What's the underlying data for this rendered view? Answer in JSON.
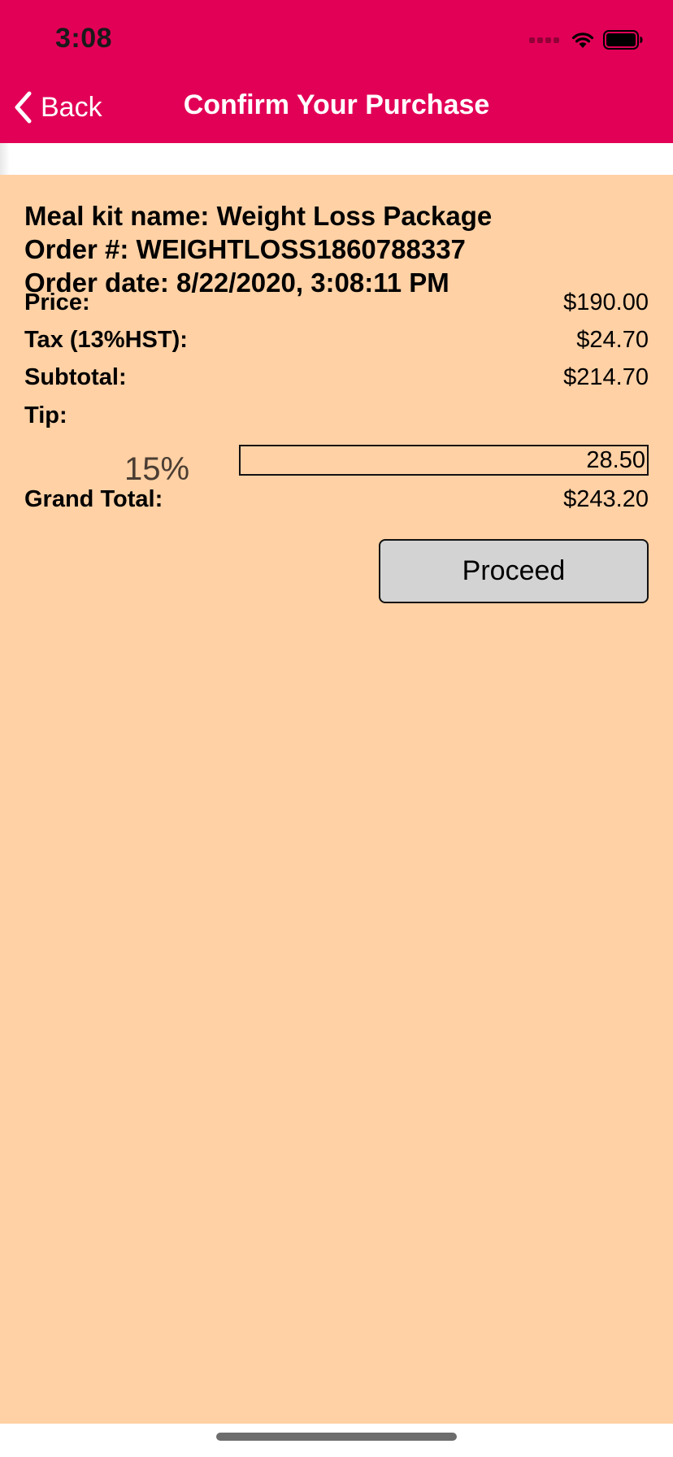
{
  "status_bar": {
    "time": "3:08"
  },
  "nav": {
    "back_label": "Back",
    "title": "Confirm Your Purchase"
  },
  "order": {
    "meal_kit_line": "Meal kit name: Weight Loss Package",
    "order_number_line": "Order #: WEIGHTLOSS1860788337",
    "order_date_line": "Order date: 8/22/2020, 3:08:11 PM"
  },
  "summary": {
    "price_label": "Price:",
    "price_value": "$190.00",
    "tax_label": "Tax (13%HST):",
    "tax_value": "$24.70",
    "subtotal_label": "Subtotal:",
    "subtotal_value": "$214.70",
    "tip_label": "Tip:",
    "tip_percent": "15%",
    "tip_value": "28.50",
    "grand_total_label": "Grand Total:",
    "grand_total_value": "$243.20"
  },
  "actions": {
    "proceed_label": "Proceed"
  },
  "colors": {
    "header_bg": "#e20057",
    "content_bg": "#ffd1a5",
    "button_bg": "#d3d3d3"
  }
}
